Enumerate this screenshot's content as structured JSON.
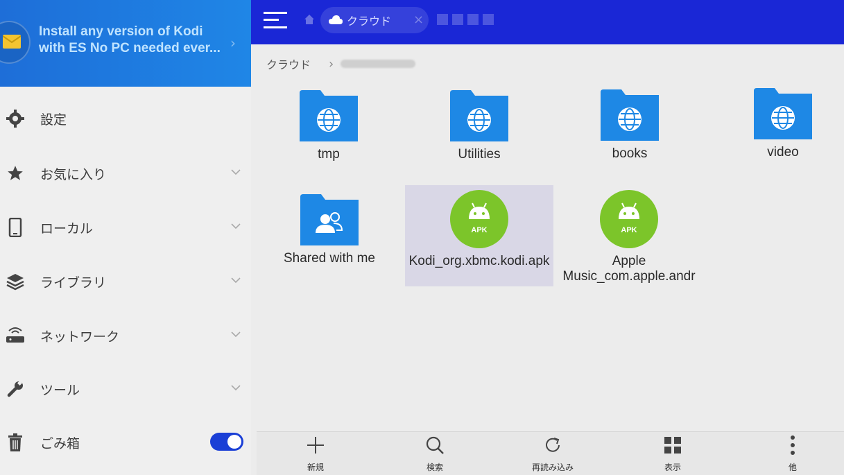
{
  "promo": {
    "line1": "Install any version of Kodi",
    "line2": "with ES No PC needed ever...",
    "icon": "mail-icon"
  },
  "sidebar": {
    "items": [
      {
        "label": "設定",
        "icon": "gear-icon"
      },
      {
        "label": "お気に入り",
        "icon": "star-icon"
      },
      {
        "label": "ローカル",
        "icon": "phone-icon"
      },
      {
        "label": "ライブラリ",
        "icon": "layers-icon"
      },
      {
        "label": "ネットワーク",
        "icon": "router-icon"
      },
      {
        "label": "ツール",
        "icon": "wrench-icon"
      },
      {
        "label": "ごみ箱",
        "icon": "trash-icon"
      }
    ],
    "recycle_bin_enabled": true
  },
  "topbar": {
    "tab_label": "クラウド"
  },
  "breadcrumb": {
    "root": "クラウド"
  },
  "files": [
    {
      "name": "tmp",
      "type": "cloud-folder"
    },
    {
      "name": "Utilities",
      "type": "cloud-folder"
    },
    {
      "name": "books",
      "type": "cloud-folder"
    },
    {
      "name": "video",
      "type": "cloud-folder"
    },
    {
      "name": "Shared with me",
      "type": "shared-folder"
    },
    {
      "name": "Kodi_org.xbmc.kodi.apk",
      "type": "apk",
      "apk_label": "APK"
    },
    {
      "name": "Apple Music_com.apple.andr",
      "type": "apk",
      "apk_label": "APK"
    }
  ],
  "toolbar": {
    "new_label": "新規",
    "search_label": "検索",
    "reload_label": "再読み込み",
    "view_label": "表示",
    "more_label": "他"
  },
  "colors": {
    "topbar": "#1a27d6",
    "promo": "#1f7ae2",
    "folder": "#1e88e5",
    "apk": "#7cc52a",
    "toggle": "#1a3fd6"
  }
}
